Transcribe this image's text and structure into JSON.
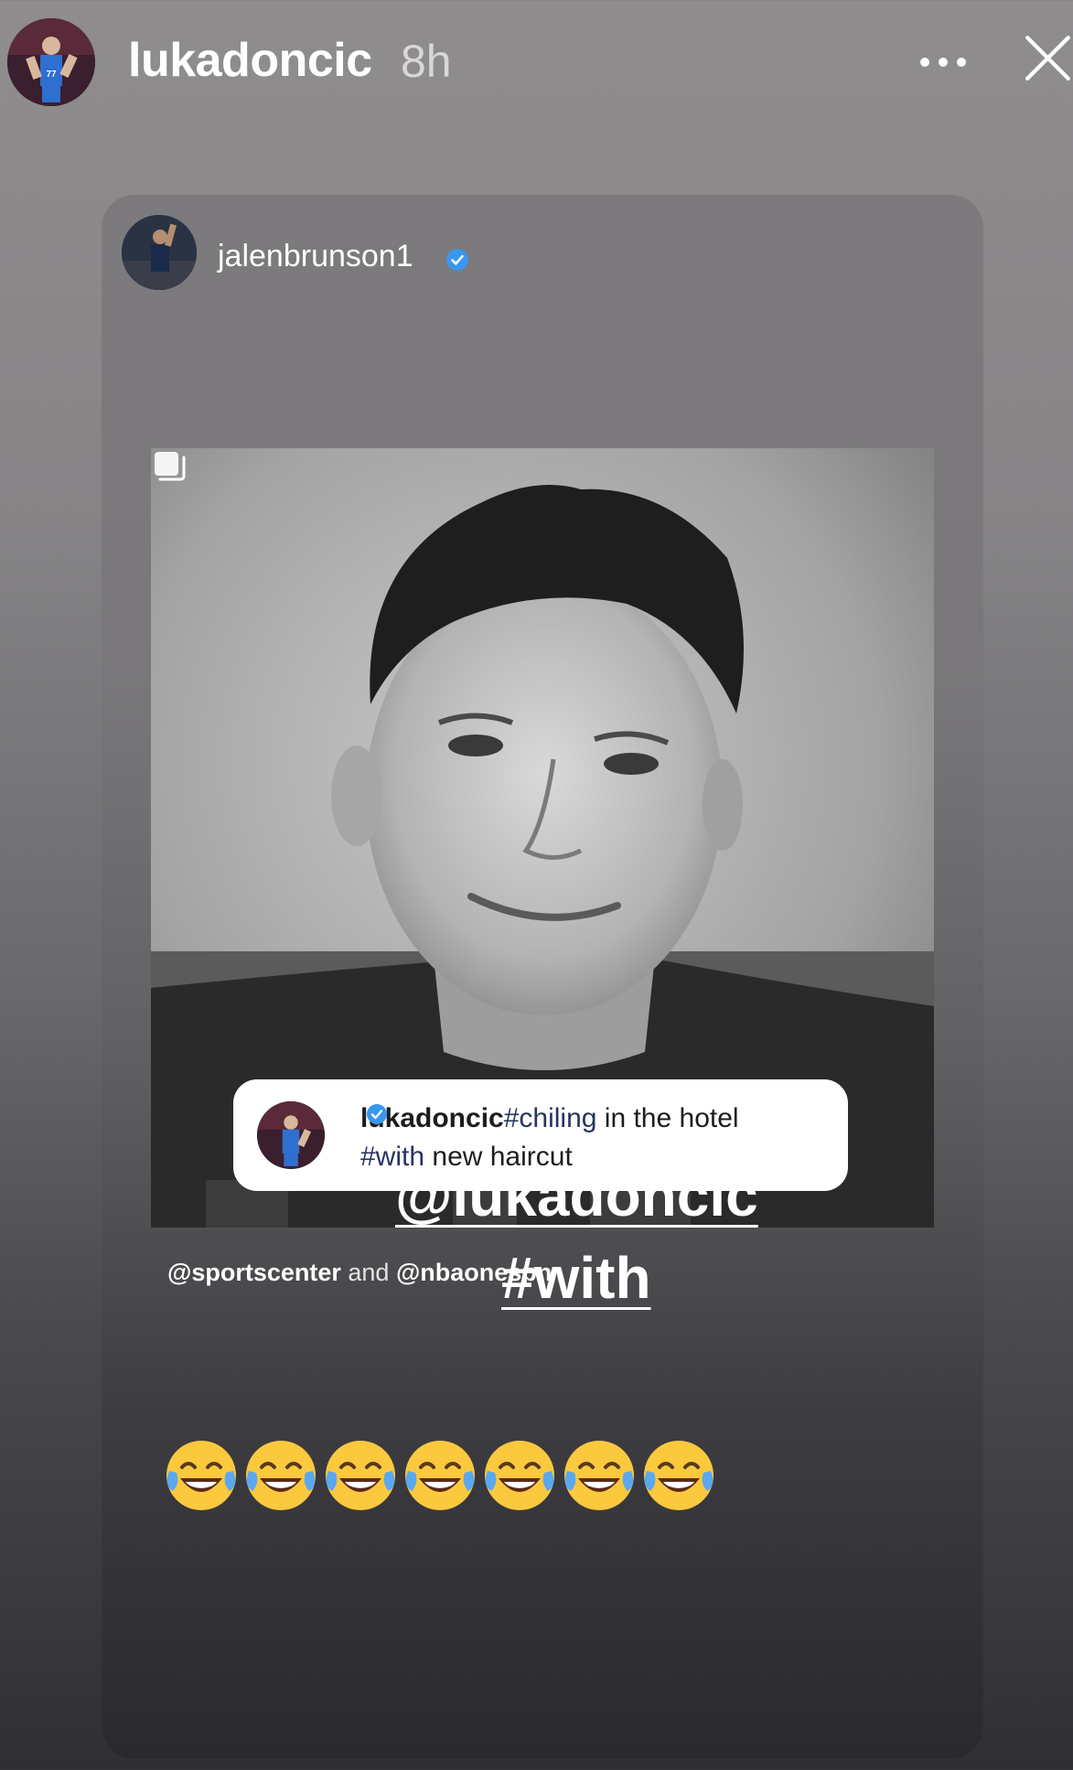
{
  "header": {
    "username": "lukadoncic",
    "time": "8h"
  },
  "card": {
    "username": "jalenbrunson1",
    "caption": {
      "username": "lukadoncic",
      "hashtag1": "#chiling",
      "text1": " in the hotel",
      "hashtag2": "#with",
      "text2": " new haircut"
    },
    "credit": {
      "handle1": "@sportscenter",
      "joiner": " and ",
      "handle2": "@nbaonespn"
    },
    "sticker_mention": "@lukadoncic",
    "sticker_hashtag": "#with",
    "emoji_count": 7
  },
  "colors": {
    "verified": "#3897f0",
    "hashtag": "#27345f"
  },
  "icons": [
    "more-icon",
    "close-icon",
    "verified-icon",
    "multiple-posts-icon",
    "laughing-crying-emoji"
  ]
}
